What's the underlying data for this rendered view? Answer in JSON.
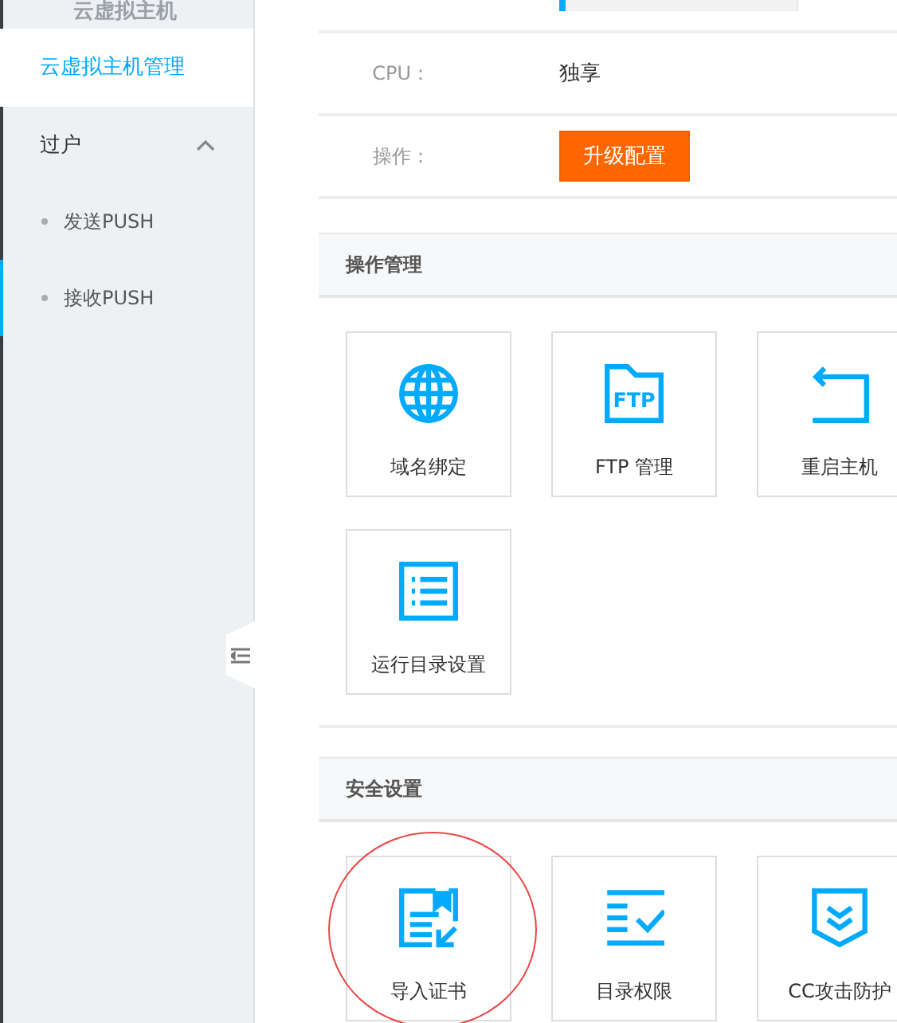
{
  "sidebar": {
    "header": "云虚拟主机",
    "items": [
      {
        "label": "云虚拟主机管理",
        "selected": true
      }
    ],
    "groups": [
      {
        "label": "过户",
        "expanded": true,
        "children": [
          {
            "label": "发送PUSH",
            "selected": false
          },
          {
            "label": "接收PUSH",
            "selected": true
          }
        ]
      }
    ]
  },
  "usage_bar": {
    "level": 0.03
  },
  "info_rows": [
    {
      "kind": "text",
      "label": "CPU：",
      "value": "独享"
    },
    {
      "kind": "button",
      "label": "操作：",
      "value": "升级配置"
    }
  ],
  "sections": [
    {
      "title": "操作管理",
      "tiles": [
        {
          "kind": "globe",
          "label": "域名绑定",
          "circled": false
        },
        {
          "kind": "ftp",
          "icon_text": "FTP",
          "label": "FTP 管理",
          "circled": false
        },
        {
          "kind": "restart",
          "label": "重启主机",
          "circled": false
        },
        {
          "kind": "list",
          "label": "运行目录设置",
          "circled": false
        }
      ]
    },
    {
      "title": "安全设置",
      "tiles": [
        {
          "kind": "certificate",
          "label": "导入证书",
          "circled": true
        },
        {
          "kind": "permission",
          "label": "目录权限",
          "circled": false
        },
        {
          "kind": "shield",
          "label": "CC攻击防护",
          "circled": false
        }
      ]
    }
  ]
}
